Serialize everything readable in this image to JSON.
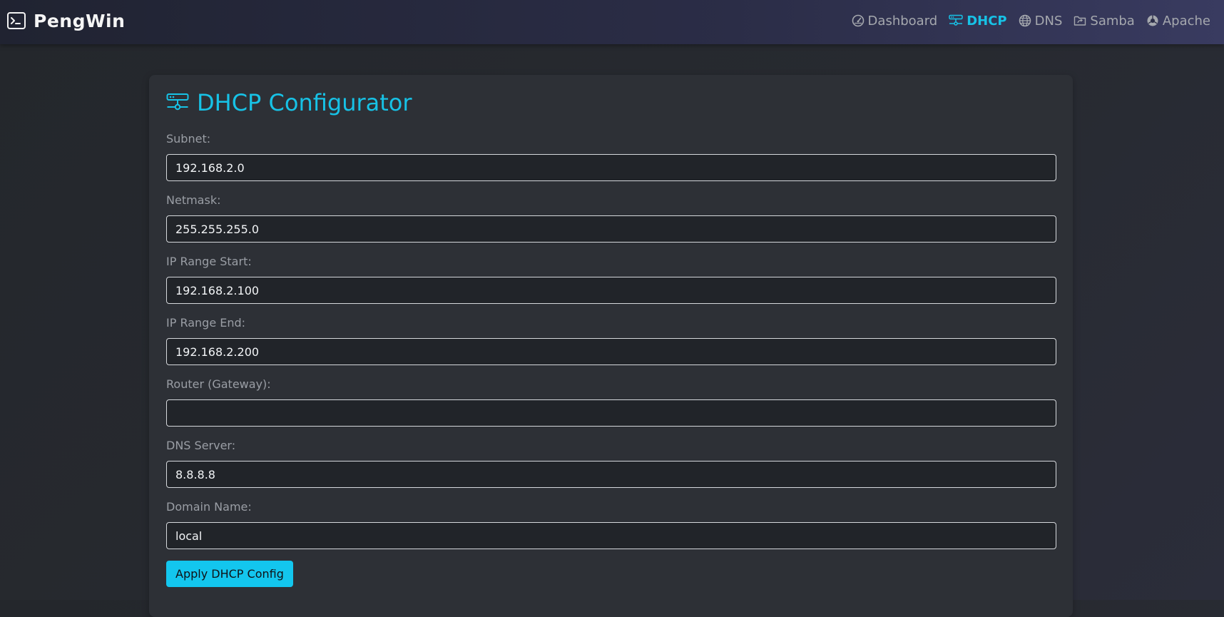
{
  "app": {
    "brand": "PengWin",
    "brand_icon": "terminal-icon"
  },
  "nav": [
    {
      "label": "Dashboard",
      "icon": "speedometer-icon",
      "active": false
    },
    {
      "label": "DHCP",
      "icon": "network-icon",
      "active": true
    },
    {
      "label": "DNS",
      "icon": "globe-icon",
      "active": false
    },
    {
      "label": "Samba",
      "icon": "folder-share-icon",
      "active": false
    },
    {
      "label": "Apache",
      "icon": "browser-icon",
      "active": false
    }
  ],
  "page": {
    "title": "DHCP Configurator",
    "title_icon": "network-icon"
  },
  "form": {
    "fields": [
      {
        "label": "Subnet:",
        "value": "192.168.2.0"
      },
      {
        "label": "Netmask:",
        "value": "255.255.255.0"
      },
      {
        "label": "IP Range Start:",
        "value": "192.168.2.100"
      },
      {
        "label": "IP Range End:",
        "value": "192.168.2.200"
      },
      {
        "label": "Router (Gateway):",
        "value": ""
      },
      {
        "label": "DNS Server:",
        "value": "8.8.8.8"
      },
      {
        "label": "Domain Name:",
        "value": "local"
      }
    ],
    "submit_label": "Apply DHCP Config"
  },
  "colors": {
    "accent": "#17c2e6",
    "button": "#13c6ee",
    "card": "#2d3036",
    "input_bg": "#212429"
  }
}
